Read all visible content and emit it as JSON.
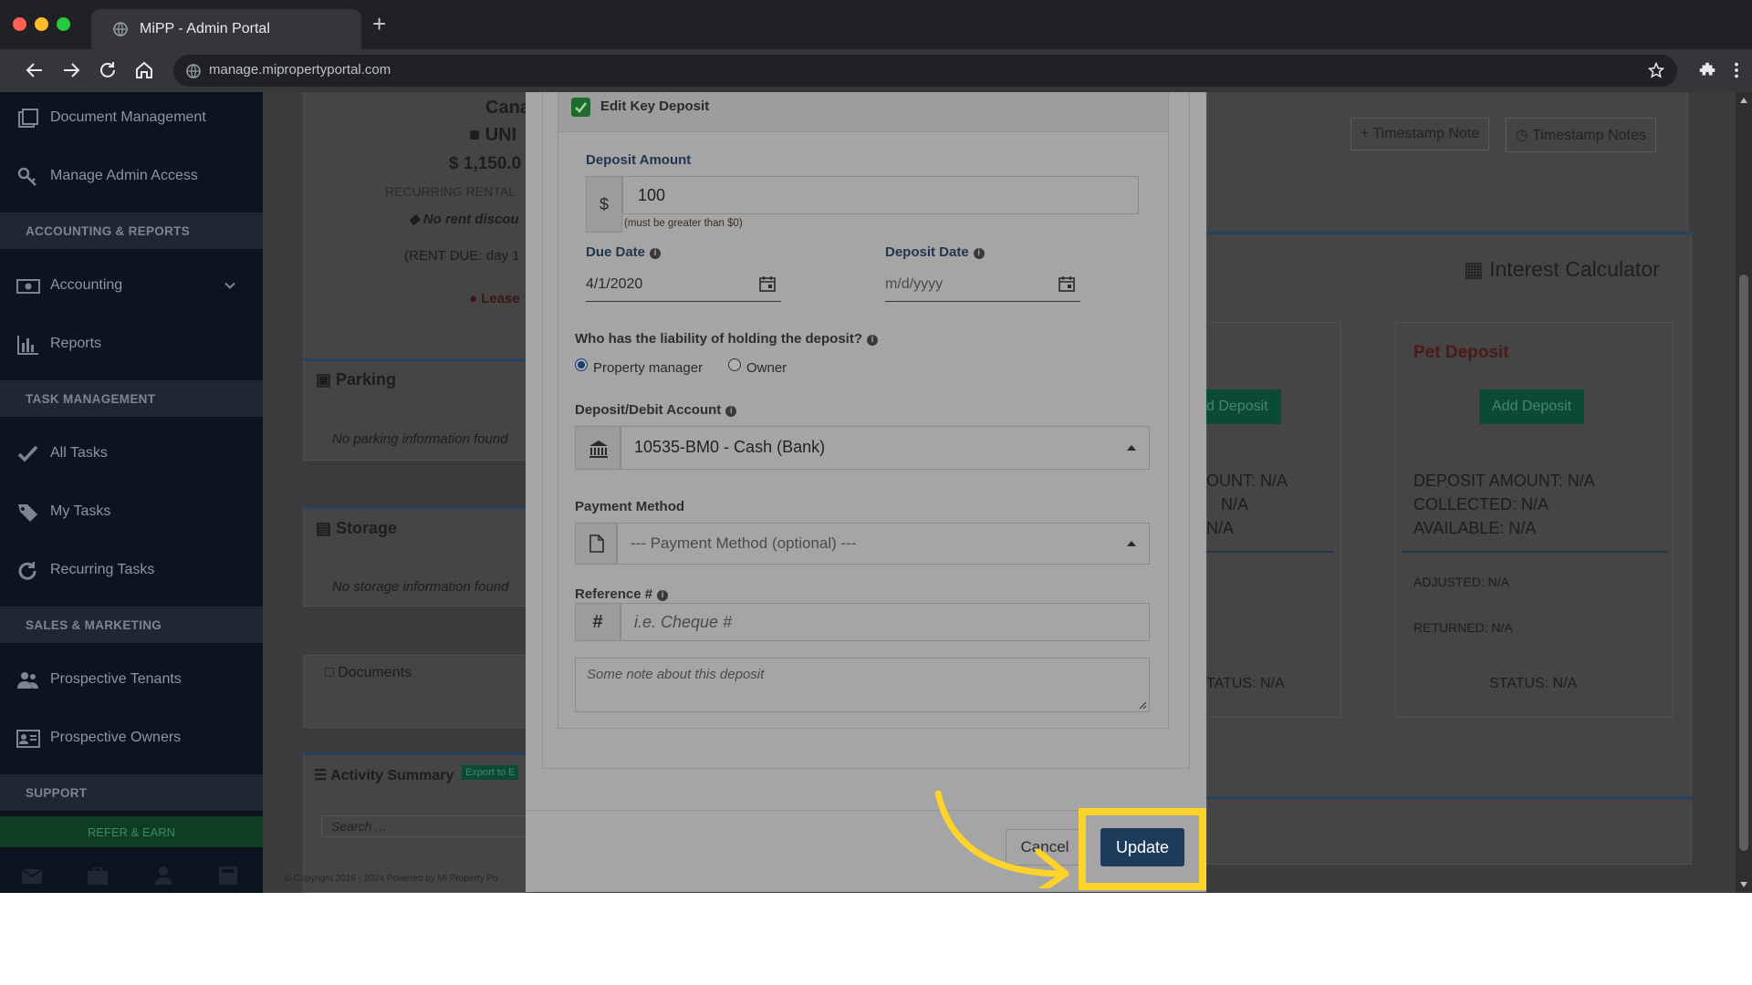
{
  "browser": {
    "tab_title": "MiPP - Admin Portal",
    "new_tab": "+",
    "url": "manage.mipropertyportal.com"
  },
  "sidebar": {
    "items": [
      {
        "label": "Document Management",
        "icon": "folder-icon"
      },
      {
        "label": "Manage Admin Access",
        "icon": "key-icon"
      },
      {
        "label": "Accounting",
        "icon": "money-icon"
      },
      {
        "label": "Reports",
        "icon": "bar-chart-icon"
      },
      {
        "label": "All Tasks",
        "icon": "check-icon"
      },
      {
        "label": "My Tasks",
        "icon": "tag-icon"
      },
      {
        "label": "Recurring Tasks",
        "icon": "refresh-icon"
      },
      {
        "label": "Prospective Tenants",
        "icon": "users-icon"
      },
      {
        "label": "Prospective Owners",
        "icon": "id-card-icon"
      }
    ],
    "sections": [
      "ACCOUNTING & REPORTS",
      "TASK MANAGEMENT",
      "SALES & MARKETING",
      "SUPPORT"
    ],
    "refer": "REFER & EARN"
  },
  "background": {
    "address_frag": "Cana",
    "unit_frag": "UNI",
    "rent_amount": "$ 1,150.0",
    "recurring_rental": "RECURRING RENTAL",
    "no_rent_discount": "No rent discou",
    "rent_due": "(RENT DUE: day 1",
    "lease_frag": "Lease",
    "parking_title": "Parking",
    "parking_empty": "No parking information found",
    "storage_title": "Storage",
    "storage_empty": "No storage information found",
    "documents_title": "Documents",
    "activity_title": "Activity Summary",
    "export_label": "Export to E",
    "search_placeholder": "Search ...",
    "copyright": "© Copyright 2016 - 2024 Powered by Mi Property Po",
    "timestamp_note": "Timestamp Note",
    "timestamp_notes": "Timestamp Notes",
    "interest_calculator": "Interest Calculator",
    "add_deposit_frag": "d Deposit",
    "amount_frag": "OUNT: N/A",
    "na_frag1": "N/A",
    "na_frag2": "N/A",
    "status_frag": "TATUS: N/A",
    "pet_deposit": {
      "title": "Pet Deposit",
      "add_button": "Add Deposit",
      "deposit_amount": "DEPOSIT AMOUNT: N/A",
      "collected": "COLLECTED: N/A",
      "available": "AVAILABLE: N/A",
      "adjusted": "ADJUSTED: N/A",
      "returned": "RETURNED: N/A",
      "status": "STATUS: N/A"
    }
  },
  "modal": {
    "section_title": "Edit Key Deposit",
    "deposit_amount_label": "Deposit Amount",
    "currency_symbol": "$",
    "deposit_amount_value": "100",
    "deposit_amount_hint": "(must be greater than $0)",
    "due_date_label": "Due Date",
    "due_date_value": "4/1/2020",
    "deposit_date_label": "Deposit Date",
    "deposit_date_placeholder": "m/d/yyyy",
    "liability_question": "Who has the liability of holding the deposit?",
    "liability_options": [
      "Property manager",
      "Owner"
    ],
    "liability_selected": "Property manager",
    "account_label": "Deposit/Debit Account",
    "account_value": "10535-BM0 - Cash (Bank)",
    "payment_method_label": "Payment Method",
    "payment_method_placeholder": "--- Payment Method (optional) ---",
    "reference_label": "Reference #",
    "reference_symbol": "#",
    "reference_placeholder": "i.e. Cheque #",
    "note_placeholder": "Some note about this deposit",
    "cancel_label": "Cancel",
    "update_label": "Update"
  },
  "colors": {
    "highlight": "#ffd42a",
    "update_button": "#1d3c5c",
    "sidebar": "#0d1420"
  }
}
